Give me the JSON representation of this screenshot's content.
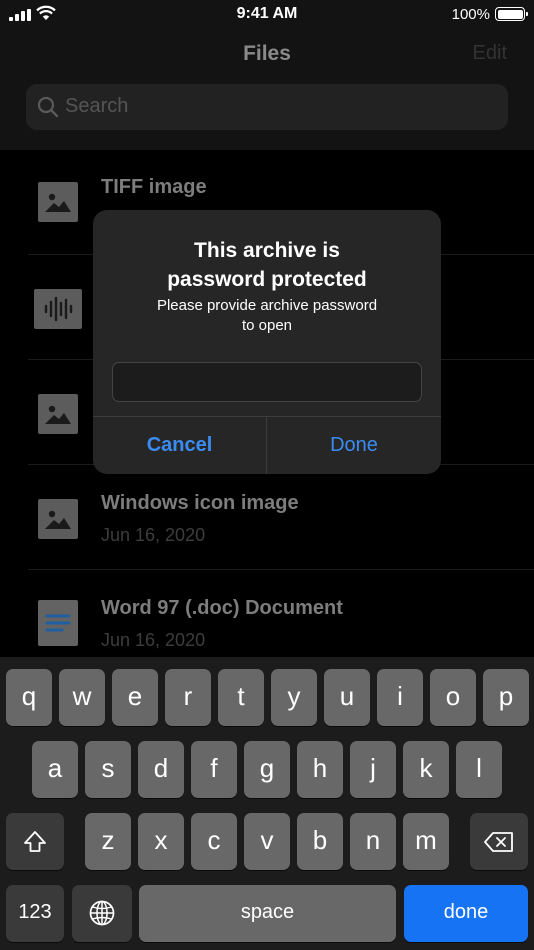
{
  "status_bar": {
    "time": "9:41 AM",
    "battery_percent": "100%"
  },
  "header": {
    "title": "Files",
    "edit_label": "Edit",
    "search_placeholder": "Search"
  },
  "files": [
    {
      "name": "TIFF image",
      "date": "",
      "icon": "image-file-icon"
    },
    {
      "name": "",
      "date": "",
      "icon": "audio-file-icon"
    },
    {
      "name": "",
      "date": "",
      "icon": "image-file-icon"
    },
    {
      "name": "Windows icon image",
      "date": "Jun 16, 2020",
      "icon": "image-file-icon"
    },
    {
      "name": "Word 97 (.doc) Document",
      "date": "Jun 16, 2020",
      "icon": "document-file-icon"
    }
  ],
  "dialog": {
    "title_line1": "This archive is",
    "title_line2": "password protected",
    "message_line1": "Please provide archive password",
    "message_line2": "to open",
    "password_value": "",
    "cancel_label": "Cancel",
    "done_label": "Done"
  },
  "keyboard": {
    "row1": [
      "q",
      "w",
      "e",
      "r",
      "t",
      "y",
      "u",
      "i",
      "o",
      "p"
    ],
    "row2": [
      "a",
      "s",
      "d",
      "f",
      "g",
      "h",
      "j",
      "k",
      "l"
    ],
    "row3": [
      "z",
      "x",
      "c",
      "v",
      "b",
      "n",
      "m"
    ],
    "numbers_label": "123",
    "space_label": "space",
    "done_label": "done",
    "accent_color": "#1673f3"
  }
}
